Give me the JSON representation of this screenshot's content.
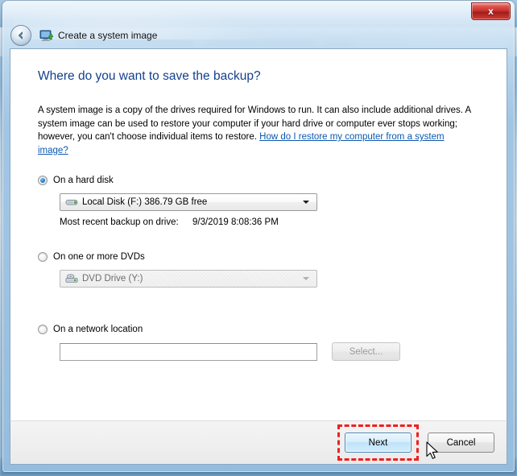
{
  "window": {
    "title": "Create a system image",
    "title_icon": "system-image-icon",
    "back_button": "back-arrow-icon",
    "close_button": "x"
  },
  "page": {
    "heading": "Where do you want to save the backup?",
    "body_part1": "A system image is a copy of the drives required for Windows to run. It can also include additional drives. A system image can be used to restore your computer if your hard drive or computer ever stops working; however, you can't choose individual items to restore. ",
    "help_link": "How do I restore my computer from a system image?"
  },
  "options": {
    "hard_disk": {
      "label": "On a hard disk",
      "selected": true,
      "combo_value": "Local Disk (F:)  386.79 GB free",
      "combo_icon": "hard-disk-icon",
      "recent_backup_label": "Most recent backup on drive:",
      "recent_backup_value": "9/3/2019 8:08:36 PM"
    },
    "dvd": {
      "label": "On one or more DVDs",
      "selected": false,
      "combo_value": "DVD Drive (Y:)",
      "combo_icon": "dvd-drive-icon",
      "disabled": true
    },
    "network": {
      "label": "On a network location",
      "selected": false,
      "input_value": "",
      "input_placeholder": "",
      "select_button": "Select...",
      "select_disabled": true
    }
  },
  "footer": {
    "next_label": "Next",
    "cancel_label": "Cancel"
  },
  "colors": {
    "heading_blue": "#14408c",
    "link_blue": "#0b58b0",
    "highlight_red": "#ef2020",
    "radio_blue": "#2a7fc9",
    "close_red": "#c22b25"
  }
}
